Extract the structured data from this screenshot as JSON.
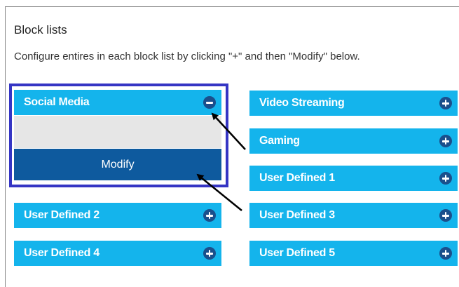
{
  "section": {
    "title": "Block lists",
    "description": "Configure entires in each block list by clicking \"+\" and then \"Modify\" below."
  },
  "social_media": {
    "label": "Social Media",
    "icon": "minus-icon",
    "modify_label": "Modify"
  },
  "left_lists": [
    {
      "label": "User Defined 2",
      "icon": "plus-icon"
    },
    {
      "label": "User Defined 4",
      "icon": "plus-icon"
    }
  ],
  "right_lists": [
    {
      "label": "Video Streaming",
      "icon": "plus-icon"
    },
    {
      "label": "Gaming",
      "icon": "plus-icon"
    },
    {
      "label": "User Defined 1",
      "icon": "plus-icon"
    },
    {
      "label": "User Defined 3",
      "icon": "plus-icon"
    },
    {
      "label": "User Defined 5",
      "icon": "plus-icon"
    }
  ],
  "colors": {
    "list_button": "#14b4ec",
    "modify_button": "#0e5a9e",
    "icon_circle": "#1a4f8c",
    "highlight_border": "#3535c4"
  }
}
